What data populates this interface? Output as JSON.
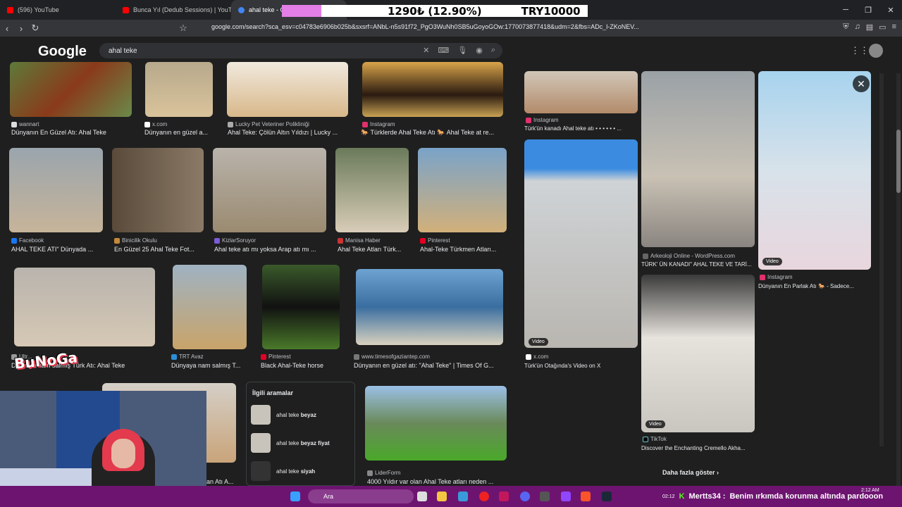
{
  "tabs": [
    {
      "label": "(596) YouTube",
      "color": "#ff0000"
    },
    {
      "label": "Bunca Yıl (Dedub Sessions) | YouT",
      "color": "#ff0000"
    },
    {
      "label": "ahal teke - G",
      "color": "#4285f4"
    }
  ],
  "overlay": {
    "price": "1290₺ (12.90%)",
    "total": "TRY10000"
  },
  "url": "google.com/search?sca_esv=c04783e6906b025b&sxsrf=ANbL-n5s91f72_PgO3WuNh0SB5uGoyoGOw:1770073877418&udm=2&fbs=ADc_l-ZKoNEV...",
  "logo": "Google",
  "search": {
    "value": "ahal teke"
  },
  "results": [
    {
      "src": "wannart",
      "cap": "Dünyanın En Güzel Atı: Ahal Teke"
    },
    {
      "src": "x.com",
      "cap": "Dünyanın en güzel a..."
    },
    {
      "src": "Lucky Pet Veteriner Polikliniği",
      "cap": "Ahal Teke: Çölün Altın Yıldızı | Lucky ..."
    },
    {
      "src": "Instagram",
      "cap": "🐎 Türklerde Ahal Teke Atı 🐎 Ahal Teke at re..."
    },
    {
      "src": "Facebook",
      "cap": "AHAL TEKE ATI\" Dünyada ..."
    },
    {
      "src": "Binicilik Okulu",
      "cap": "En Güzel 25 Ahal Teke Fot..."
    },
    {
      "src": "KizlarSoruyor",
      "cap": "Ahal teke atı mı yoksa Arap atı mı ..."
    },
    {
      "src": "Manisa Haber",
      "cap": "Ahal Teke Atları Türk..."
    },
    {
      "src": "Pinterest",
      "cap": "Ahal-Teke Türkmen Atları..."
    },
    {
      "src": "Ultr...",
      "cap": "Dünyaya nam salmış Türk Atı: Ahal Teke"
    },
    {
      "src": "TRT Avaz",
      "cap": "Dünyaya nam salmış T..."
    },
    {
      "src": "Pinterest",
      "cap": "Black Ahal-Teke horse"
    },
    {
      "src": "www.timesofgaziantep.com",
      "cap": "Dünyanın en güzel atı: \"Ahal Teke\" | Times Of G..."
    },
    {
      "src": "LiderForm",
      "cap": "4000 Yıldır var olan Ahal Teke atları neden ..."
    },
    {
      "src": "",
      "cap": "an Atı A..."
    }
  ],
  "right_panel": [
    {
      "src": "Instagram",
      "cap": "Türk'ün kanadı Ahal teke atı • • • • • • ..."
    },
    {
      "src": "Arkeoloji Online - WordPress.com",
      "cap": "TÜRK' ÜN KANADI\" AHAL TEKE VE TARİ..."
    },
    {
      "src": "Instagram",
      "cap": "Dünyanın En Parlak Atı 🐎 - Sadece..."
    },
    {
      "src": "x.com",
      "cap": "Türk'ün Otağında's Video on X"
    },
    {
      "src": "TikTok",
      "cap": "Discover the Enchanting Cremello Akha..."
    }
  ],
  "video_label": "Video",
  "related": {
    "title": "İlgili aramalar",
    "items": [
      {
        "base": "ahal teke ",
        "bold": "beyaz"
      },
      {
        "base": "ahal teke ",
        "bold": "beyaz fiyat"
      },
      {
        "base": "ahal teke ",
        "bold": "siyah"
      }
    ]
  },
  "more_label": "Daha fazla göster",
  "overlay_text": {
    "bunoga": "BuNoGa"
  },
  "taskbar": {
    "search_placeholder": "Ara",
    "time": "2:12 AM"
  },
  "ticker": {
    "time": "02:12",
    "user": "Mertts34 :",
    "msg": "Benim ırkımda korunma altında pardooon"
  }
}
